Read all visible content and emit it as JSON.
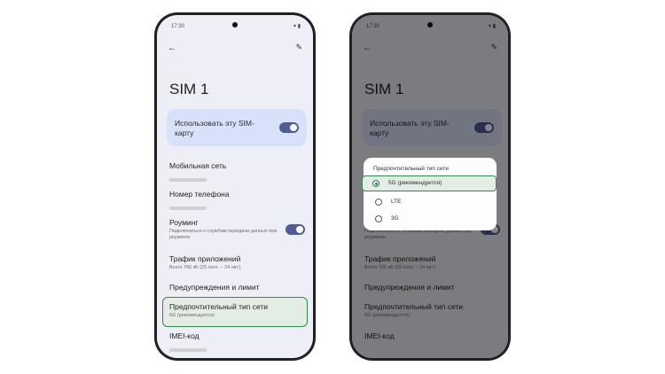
{
  "status": {
    "time": "17:30",
    "icons": "▾ ▮"
  },
  "header": {
    "title": "SIM 1"
  },
  "sim_card": {
    "use_label": "Использовать эту SIM-карту",
    "enabled": true
  },
  "settings": [
    {
      "title": "Мобильная сеть",
      "subtitle": ""
    },
    {
      "title": "Номер телефона",
      "subtitle": ""
    },
    {
      "title": "Роуминг",
      "subtitle": "Подключаться к службам передачи данных при роуминге",
      "toggle": true
    },
    {
      "title": "Трафик приложений",
      "subtitle": "Всего 766 кБ (25 сент. – 24 окт.)"
    },
    {
      "title": "Предупреждения и лимит",
      "subtitle": ""
    },
    {
      "title": "Предпочтительный тип сети",
      "subtitle": "5G (рекомендуется)"
    },
    {
      "title": "IMEI-код",
      "subtitle": ""
    }
  ],
  "dialog": {
    "title": "Предпочтительный тип сети",
    "options": [
      {
        "label": "5G (рекомендуется)",
        "selected": true
      },
      {
        "label": "LTE",
        "selected": false
      },
      {
        "label": "3G",
        "selected": false
      }
    ]
  },
  "colors": {
    "accent": "#4f5d96",
    "highlight": "#2f8a4f",
    "card": "#d8e0fa"
  },
  "icons": {
    "back": "arrow-left",
    "edit": "pencil"
  }
}
